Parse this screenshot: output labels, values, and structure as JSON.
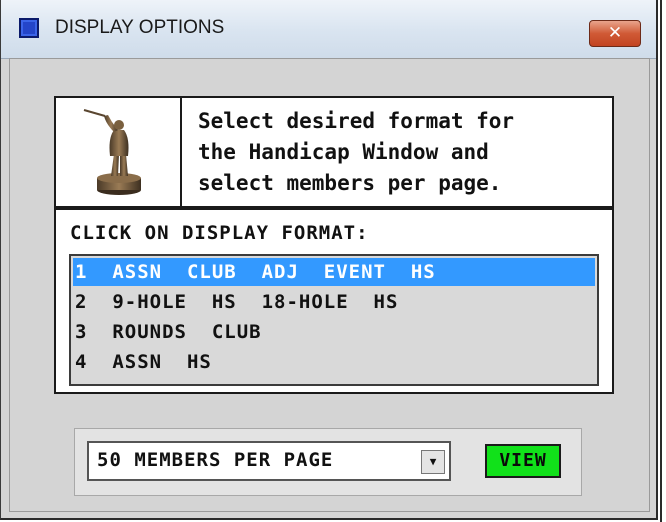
{
  "window": {
    "title": "DISPLAY OPTIONS",
    "close_symbol": "✕"
  },
  "header": {
    "image": "golfer-trophy-icon",
    "instructions": "Select desired format for\nthe Handicap Window and\nselect members per page."
  },
  "format": {
    "label": "CLICK ON DISPLAY FORMAT:",
    "items": [
      {
        "label": "1  ASSN  CLUB  ADJ  EVENT  HS",
        "selected": true
      },
      {
        "label": "2  9-HOLE  HS  18-HOLE  HS",
        "selected": false
      },
      {
        "label": "3  ROUNDS  CLUB",
        "selected": false
      },
      {
        "label": "4  ASSN  HS",
        "selected": false
      }
    ]
  },
  "members": {
    "value": "50 MEMBERS PER PAGE",
    "dropdown_symbol": "▼"
  },
  "view_button": {
    "label": "VIEW"
  },
  "colors": {
    "selection": "#3399ff",
    "view_button": "#11e11a",
    "close_button": "#d05a36",
    "window_bg": "#d4d4d4"
  }
}
